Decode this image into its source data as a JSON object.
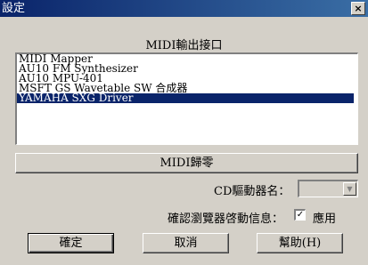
{
  "window": {
    "title": "設定",
    "close_label": "×"
  },
  "midi": {
    "heading": "MIDI輸出接口",
    "devices": [
      "MIDI Mapper",
      "AU10 FM Synthesizer",
      "AU10 MPU-401",
      "MSFT GS Wavetable SW 合成器",
      "YAMAHA SXG Driver"
    ],
    "selected_index": 4,
    "reset_label": "MIDI歸零"
  },
  "cd": {
    "label": "CD驅動器名：",
    "value": ""
  },
  "browser": {
    "label": "確認瀏覽器啓動信息：",
    "checked": true,
    "apply_label": "應用"
  },
  "buttons": {
    "ok": "確定",
    "cancel": "取消",
    "help": "幫助(H)"
  }
}
